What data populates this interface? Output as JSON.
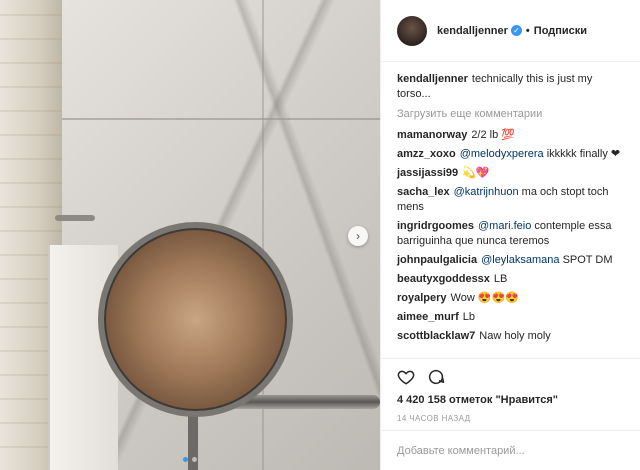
{
  "post": {
    "username": "kendalljenner",
    "follow_label": "Подписки",
    "caption": "technically this is just my torso...",
    "load_more": "Загрузить еще комментарии",
    "likes": "4 420 158 отметок \"Нравится\"",
    "timestamp": "14 ЧАСОВ НАЗАД",
    "add_comment_placeholder": "Добавьте комментарий...",
    "comments": [
      {
        "user": "mamanorway",
        "mention": "",
        "text": "2/2 lb 💯"
      },
      {
        "user": "amzz_xoxo",
        "mention": "@melodyxperera",
        "text": " ikkkkk finally ❤"
      },
      {
        "user": "jassijassi99",
        "mention": "",
        "text": "💫💖"
      },
      {
        "user": "sacha_lex",
        "mention": "@katrijnhuon",
        "text": " ma och stopt toch mens"
      },
      {
        "user": "ingridrgoomes",
        "mention": "@mari.feio",
        "text": " contemple essa barriguinha que nunca teremos"
      },
      {
        "user": "johnpaulgalicia",
        "mention": "@leylaksamana",
        "text": " SPOT DM"
      },
      {
        "user": "beautyxgoddessx",
        "mention": "",
        "text": "LB"
      },
      {
        "user": "royalpery",
        "mention": "",
        "text": "Wow 😍😍😍"
      },
      {
        "user": "aimee_murf",
        "mention": "",
        "text": "Lb"
      },
      {
        "user": "scottblacklaw7",
        "mention": "",
        "text": "Naw holy moly"
      }
    ]
  },
  "icons": {
    "verified": "verified-badge-icon",
    "like": "heart-icon",
    "comment": "comment-bubble-icon",
    "next": "chevron-right-icon"
  },
  "colors": {
    "accent": "#3897f0",
    "text": "#262626",
    "muted": "#999999",
    "mention": "#003569"
  }
}
